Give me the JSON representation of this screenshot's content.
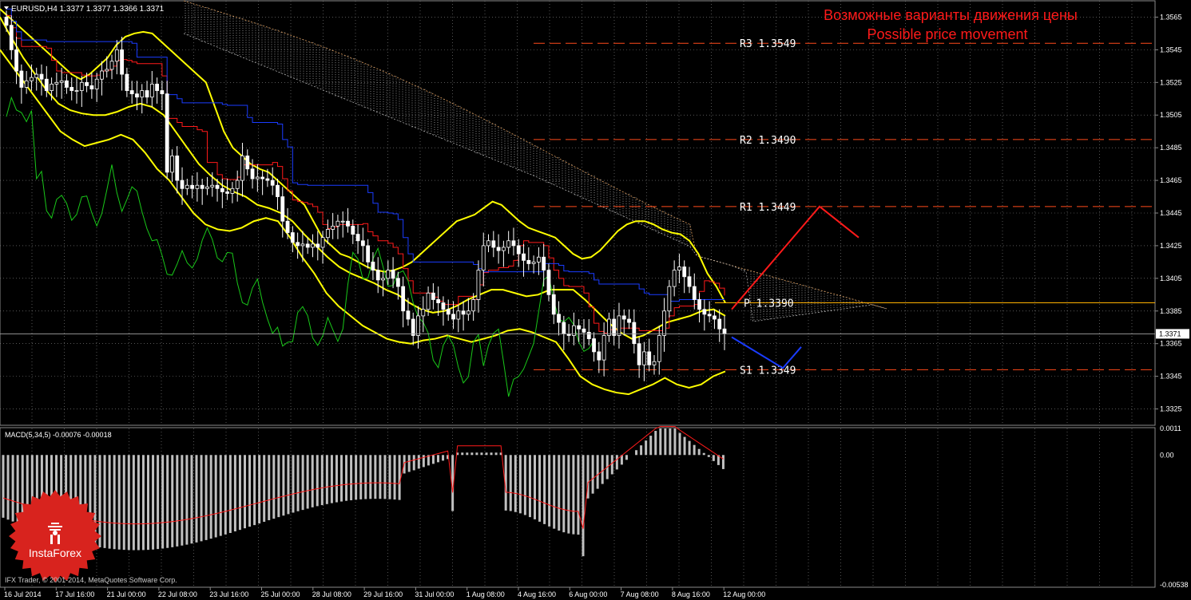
{
  "header": {
    "symbol_line": "EURUSD,H4  1.3377 1.3377 1.3366 1.3371",
    "annotation_ru": "Возможные варианты движения цены",
    "annotation_en": "Possible price movement"
  },
  "macd": {
    "label": "MACD(5,34,5) -0.00076 -0.00018",
    "y_ticks": [
      "0.0011",
      "0.00",
      "-0.00538"
    ],
    "ylim": [
      -0.00538,
      0.0011
    ]
  },
  "footer": {
    "copyright": "IFX Trader, © 2001-2014, MetaQuotes Software Corp.",
    "logo_text": "InstaForex"
  },
  "colors": {
    "background": "#000000",
    "grid": "#8a8a8a",
    "candle": "#ffffff",
    "bollinger": "#ffff00",
    "pivot_lines": "#ff4a1a",
    "pivot_main": "#ffb000",
    "tenkan": "#ff1a1a",
    "kijun": "#1a3cff",
    "chikou": "#19c819",
    "cloud": "#e8e8e8",
    "forecast_up": "#ff1a1a",
    "forecast_down": "#1a3cff",
    "macd_hist": "#c0c0c0",
    "macd_signal": "#ff1a1a",
    "logo": "#d8231e"
  },
  "chart_data": {
    "type": "candlestick",
    "symbol": "EURUSD",
    "timeframe": "H4",
    "ylim": [
      1.3315,
      1.3575
    ],
    "y_ticks": [
      "1.3565",
      "1.3545",
      "1.3525",
      "1.3505",
      "1.3485",
      "1.3465",
      "1.3445",
      "1.3425",
      "1.3405",
      "1.3385",
      "1.3365",
      "1.3345",
      "1.3325"
    ],
    "current_price": "1.3371",
    "x_ticks": [
      "16 Jul 2014",
      "17 Jul 16:00",
      "21 Jul 00:00",
      "22 Jul 08:00",
      "23 Jul 16:00",
      "25 Jul 00:00",
      "28 Jul 08:00",
      "29 Jul 16:00",
      "31 Jul 00:00",
      "1 Aug 08:00",
      "4 Aug 16:00",
      "6 Aug 00:00",
      "7 Aug 08:00",
      "8 Aug 16:00",
      "12 Aug 00:00"
    ],
    "pivot_levels": [
      {
        "label": "R3",
        "value": "1.3549"
      },
      {
        "label": "R2",
        "value": "1.3490"
      },
      {
        "label": "R1",
        "value": "1.3449"
      },
      {
        "label": "P",
        "value": "1.3390"
      },
      {
        "label": "S1",
        "value": "1.3349"
      }
    ],
    "forecast_up": [
      1.3386,
      1.3449,
      1.343
    ],
    "forecast_down": [
      1.3369,
      1.335,
      1.3363
    ],
    "closes": [
      1.356,
      1.3545,
      1.3532,
      1.3522,
      1.3526,
      1.3528,
      1.353,
      1.3527,
      1.352,
      1.3524,
      1.3525,
      1.3526,
      1.3522,
      1.352,
      1.352,
      1.3525,
      1.3523,
      1.3521,
      1.3527,
      1.3532,
      1.3533,
      1.3538,
      1.3545,
      1.353,
      1.352,
      1.3518,
      1.3516,
      1.352,
      1.3516,
      1.3524,
      1.352,
      1.3518,
      1.347,
      1.348,
      1.3465,
      1.346,
      1.3462,
      1.346,
      1.3462,
      1.346,
      1.3461,
      1.3462,
      1.346,
      1.3458,
      1.3457,
      1.346,
      1.3465,
      1.348,
      1.3472,
      1.3466,
      1.3467,
      1.3466,
      1.3465,
      1.3462,
      1.3455,
      1.344,
      1.3433,
      1.3427,
      1.3425,
      1.3426,
      1.3424,
      1.3426,
      1.3424,
      1.343,
      1.3435,
      1.3437,
      1.344,
      1.344,
      1.3437,
      1.3432,
      1.3428,
      1.3425,
      1.3415,
      1.341,
      1.3404,
      1.3405,
      1.341,
      1.3405,
      1.34,
      1.3385,
      1.338,
      1.337,
      1.3382,
      1.3386,
      1.3396,
      1.3392,
      1.339,
      1.3386,
      1.3383,
      1.338,
      1.3385,
      1.3383,
      1.3385,
      1.3392,
      1.341,
      1.3425,
      1.3428,
      1.3424,
      1.3422,
      1.3424,
      1.3428,
      1.3425,
      1.342,
      1.3416,
      1.3414,
      1.3415,
      1.3418,
      1.341,
      1.3395,
      1.3383,
      1.3378,
      1.3371,
      1.337,
      1.3376,
      1.3374,
      1.3372,
      1.3368,
      1.336,
      1.3355,
      1.337,
      1.338,
      1.337,
      1.3382,
      1.338,
      1.3378,
      1.3365,
      1.3352,
      1.336,
      1.3352,
      1.3354,
      1.337,
      1.3385,
      1.34,
      1.341,
      1.3412,
      1.3406,
      1.34,
      1.3392,
      1.3386,
      1.3383,
      1.3382,
      1.338,
      1.3374,
      1.3371
    ],
    "bb_upper": [
      1.357,
      1.3565,
      1.356,
      1.3555,
      1.355,
      1.3545,
      1.354,
      1.3535,
      1.353,
      1.3527,
      1.353,
      1.3535,
      1.354,
      1.3548,
      1.3553,
      1.3555,
      1.3556,
      1.3555,
      1.355,
      1.3545,
      1.354,
      1.3535,
      1.353,
      1.3525,
      1.351,
      1.3495,
      1.3485,
      1.348,
      1.3475,
      1.3472,
      1.347,
      1.3465,
      1.346,
      1.3455,
      1.345,
      1.344,
      1.343,
      1.3425,
      1.342,
      1.3418,
      1.3415,
      1.3412,
      1.341,
      1.3409,
      1.341,
      1.3412,
      1.3415,
      1.342,
      1.3425,
      1.343,
      1.3435,
      1.344,
      1.3442,
      1.3444,
      1.3448,
      1.3452,
      1.345,
      1.3445,
      1.344,
      1.3436,
      1.3434,
      1.3432,
      1.343,
      1.3425,
      1.342,
      1.3417,
      1.3418,
      1.3422,
      1.3428,
      1.3434,
      1.3438,
      1.344,
      1.344,
      1.3438,
      1.3435,
      1.3433,
      1.3432,
      1.3428,
      1.342,
      1.3408,
      1.34,
      1.339
    ],
    "bb_lower": [
      1.3545,
      1.3535,
      1.3525,
      1.3515,
      1.3505,
      1.3495,
      1.349,
      1.3486,
      1.3488,
      1.349,
      1.3493,
      1.349,
      1.3482,
      1.3472,
      1.3465,
      1.3455,
      1.3445,
      1.3438,
      1.3435,
      1.3434,
      1.3436,
      1.344,
      1.3442,
      1.344,
      1.343,
      1.3418,
      1.3408,
      1.3396,
      1.3388,
      1.3382,
      1.3376,
      1.3372,
      1.3368,
      1.3366,
      1.3365,
      1.3367,
      1.3368,
      1.337,
      1.3368,
      1.3366,
      1.3368,
      1.337,
      1.3373,
      1.3374,
      1.3372,
      1.3369,
      1.3366,
      1.3356,
      1.3345,
      1.334,
      1.3337,
      1.3335,
      1.3334,
      1.3337,
      1.334,
      1.3344,
      1.334,
      1.3338,
      1.334,
      1.3345,
      1.3348
    ],
    "bb_middle": [
      1.3565,
      1.3552,
      1.354,
      1.353,
      1.352,
      1.3512,
      1.3508,
      1.3506,
      1.3505,
      1.3505,
      1.3507,
      1.351,
      1.3512,
      1.351,
      1.3505,
      1.3495,
      1.3485,
      1.3475,
      1.3468,
      1.3462,
      1.3458,
      1.3455,
      1.345,
      1.3448,
      1.3445,
      1.344,
      1.3432,
      1.3425,
      1.3418,
      1.3412,
      1.3408,
      1.3405,
      1.3402,
      1.3398,
      1.3395,
      1.339,
      1.3386,
      1.3384,
      1.3385,
      1.3388,
      1.3392,
      1.3395,
      1.3398,
      1.3398,
      1.3396,
      1.3394,
      1.3395,
      1.3398,
      1.3398,
      1.3398,
      1.3392,
      1.3385,
      1.3378,
      1.3372,
      1.3368,
      1.337,
      1.3374,
      1.3378,
      1.338,
      1.3382,
      1.3385,
      1.3386,
      1.3382
    ]
  }
}
